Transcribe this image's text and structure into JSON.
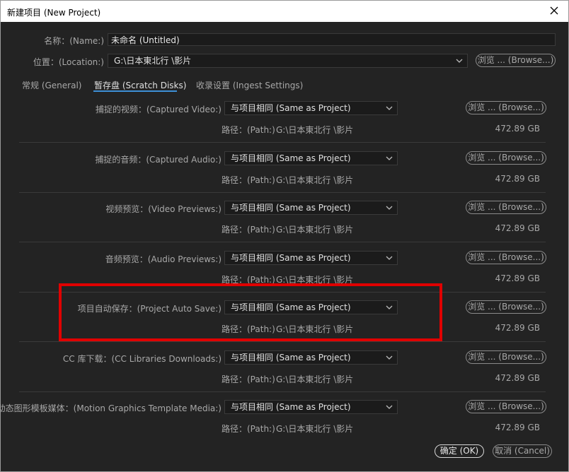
{
  "window": {
    "title": "新建项目 (New Project)"
  },
  "name": {
    "label": "名称：(Name:)",
    "value": "未命名 (Untitled)"
  },
  "location": {
    "label": "位置：(Location:)",
    "value": "G:\\日本東北行 \\影片",
    "browse_label": "浏览 ... (Browse...)"
  },
  "tabs": [
    {
      "label": "常规 (General)",
      "active": false
    },
    {
      "label": "暂存盘 (Scratch Disks)",
      "active": true
    },
    {
      "label": "收录设置 (Ingest Settings)",
      "active": false
    }
  ],
  "rows": [
    {
      "label": "捕捉的视频：(Captured Video:)",
      "select": "与项目相同 (Same as Project)",
      "path_label": "路径：(Path:)",
      "path": "G:\\日本東北行 \\影片",
      "size": "472.89 GB",
      "browse_label": "浏览 ... (Browse...)"
    },
    {
      "label": "捕捉的音频：(Captured Audio:)",
      "select": "与项目相同 (Same as Project)",
      "path_label": "路径：(Path:)",
      "path": "G:\\日本東北行 \\影片",
      "size": "472.89 GB",
      "browse_label": "浏览 ... (Browse...)"
    },
    {
      "label": "视频预览：(Video Previews:)",
      "select": "与项目相同 (Same as Project)",
      "path_label": "路径：(Path:)",
      "path": "G:\\日本東北行 \\影片",
      "size": "472.89 GB",
      "browse_label": "浏览 ... (Browse...)"
    },
    {
      "label": "音频预览：(Audio Previews:)",
      "select": "与项目相同 (Same as Project)",
      "path_label": "路径：(Path:)",
      "path": "G:\\日本東北行 \\影片",
      "size": "472.89 GB",
      "browse_label": "浏览 ... (Browse...)"
    },
    {
      "label": "项目自动保存：(Project Auto Save:)",
      "select": "与项目相同 (Same as Project)",
      "path_label": "路径：(Path:)",
      "path": "G:\\日本東北行 \\影片",
      "size": "472.89 GB",
      "browse_label": "浏览 ... (Browse...)"
    },
    {
      "label": "CC 库下载：(CC Libraries Downloads:)",
      "select": "与项目相同 (Same as Project)",
      "path_label": "路径：(Path:)",
      "path": "G:\\日本東北行 \\影片",
      "size": "472.89 GB",
      "browse_label": "浏览 ... (Browse...)"
    },
    {
      "label": "动态图形模板媒体：(Motion Graphics Template Media:)",
      "select": "与项目相同 (Same as Project)",
      "path_label": "路径：(Path:)",
      "path": "G:\\日本東北行 \\影片",
      "size": "472.89 GB",
      "browse_label": "浏览 ... (Browse...)"
    }
  ],
  "footer": {
    "ok_label": "确定 (OK)",
    "cancel_label": "取消 (Cancel)"
  },
  "colors": {
    "background": "#232323",
    "accent": "#3d8fd6",
    "highlight": "#e00000"
  }
}
